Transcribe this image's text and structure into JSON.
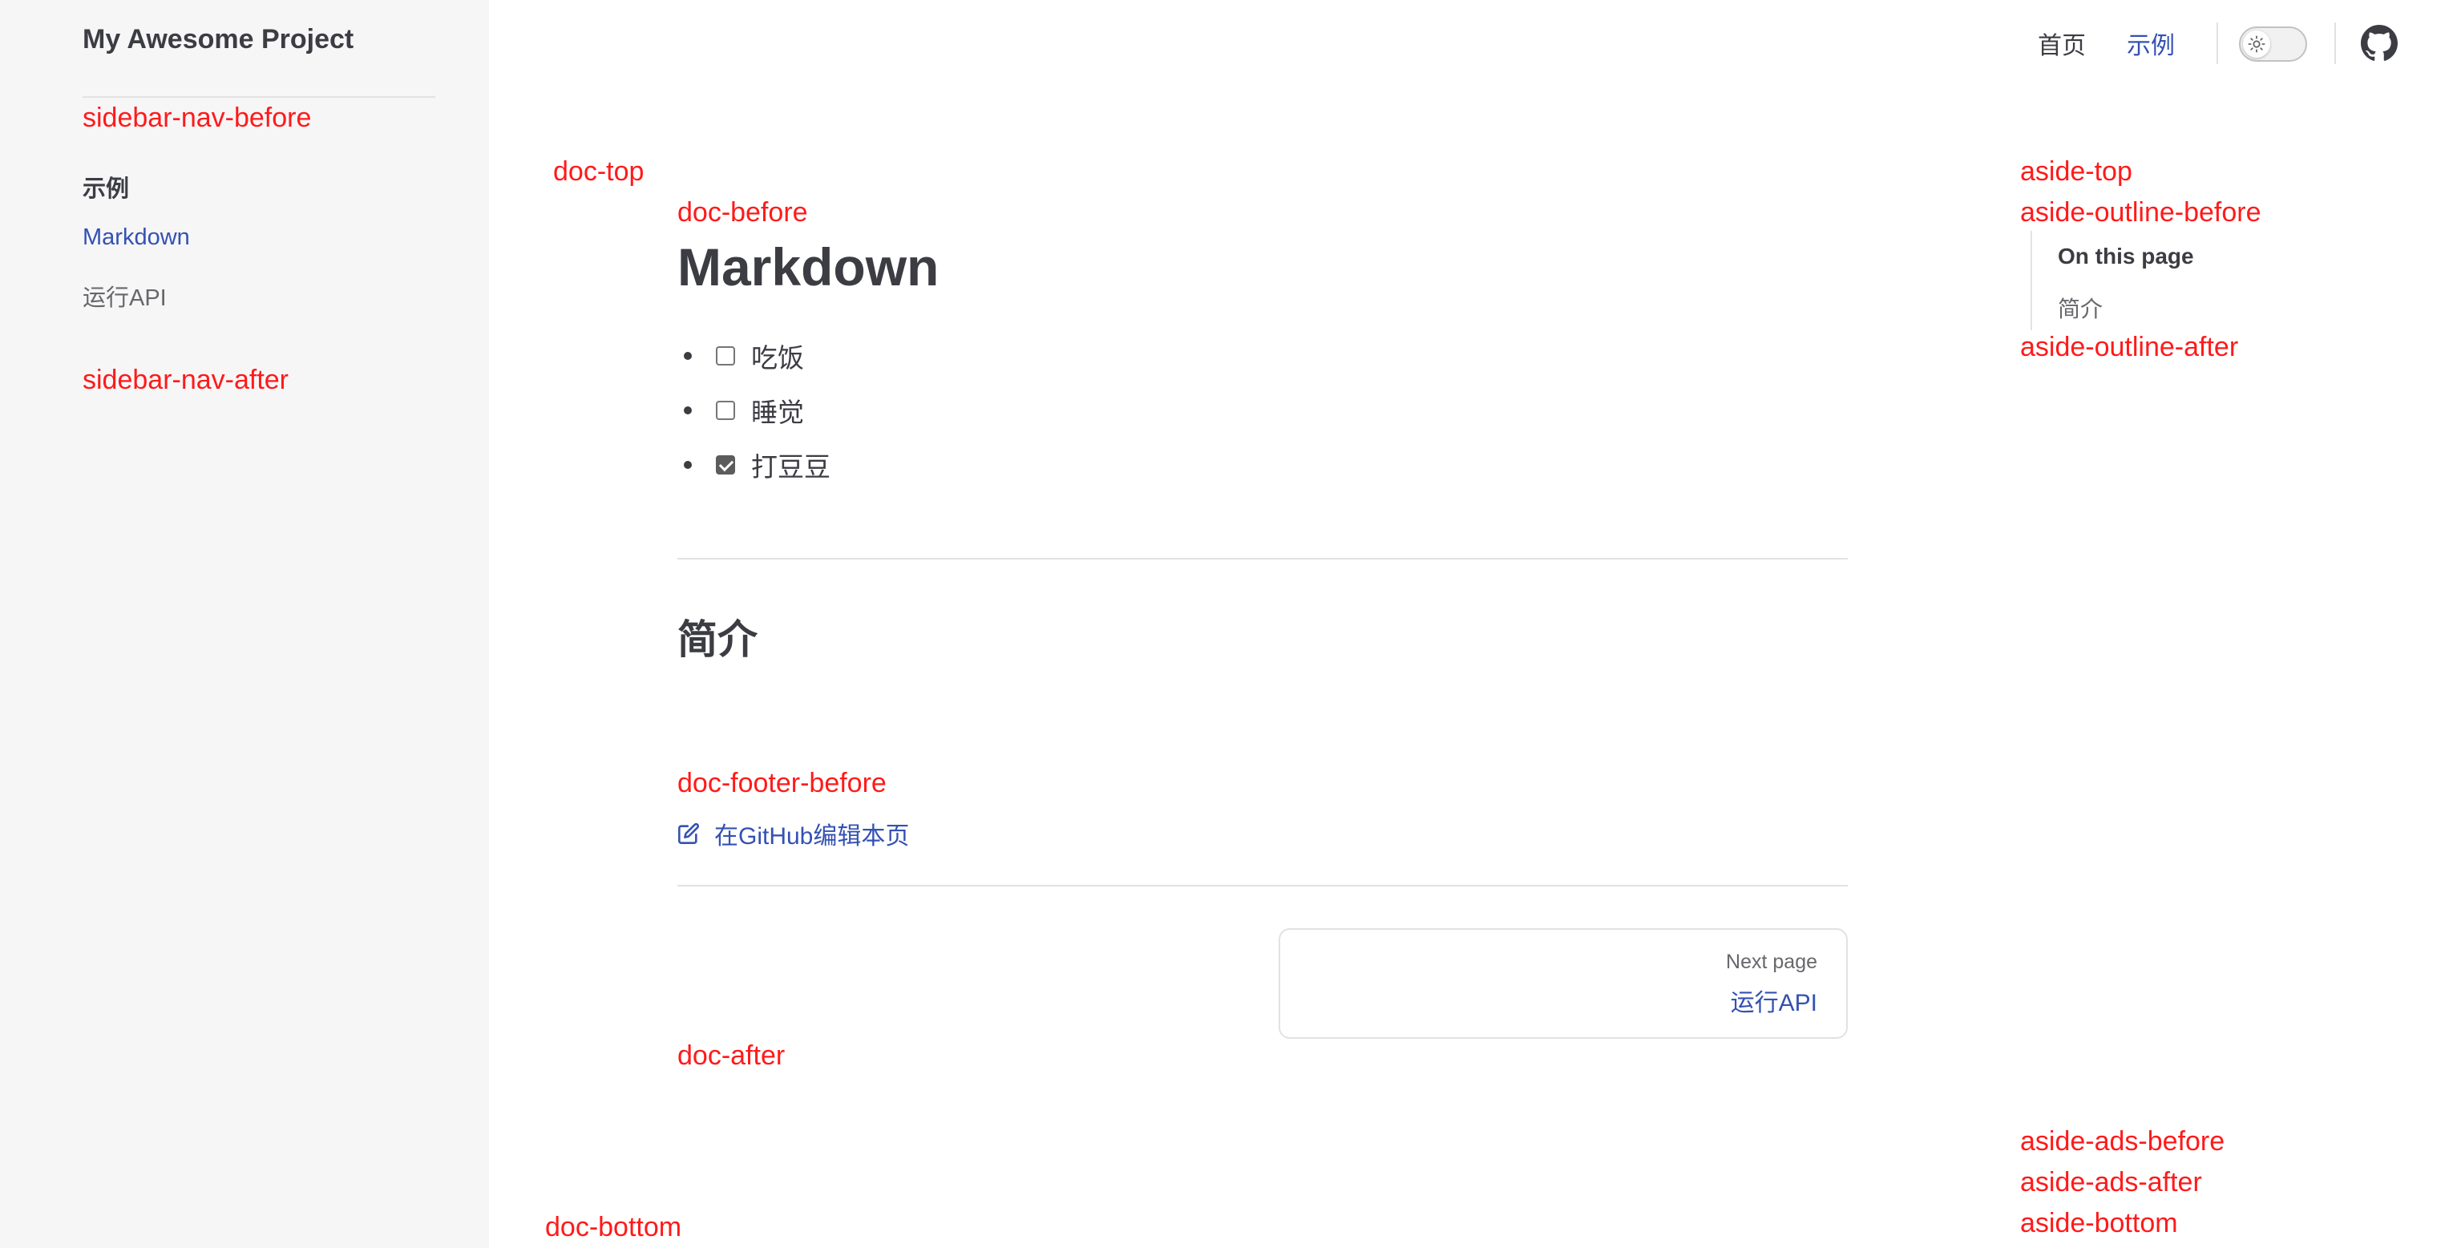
{
  "site": {
    "title": "My Awesome Project"
  },
  "nav": {
    "home": "首页",
    "example": "示例"
  },
  "sidebar": {
    "group_title": "示例",
    "items": [
      {
        "label": "Markdown",
        "active": true
      },
      {
        "label": "运行API",
        "active": false
      }
    ]
  },
  "slots": {
    "sidebar_nav_before": "sidebar-nav-before",
    "sidebar_nav_after": "sidebar-nav-after",
    "doc_top": "doc-top",
    "doc_before": "doc-before",
    "doc_footer_before": "doc-footer-before",
    "doc_after": "doc-after",
    "doc_bottom": "doc-bottom",
    "aside_top": "aside-top",
    "aside_outline_before": "aside-outline-before",
    "aside_outline_after": "aside-outline-after",
    "aside_ads_before": "aside-ads-before",
    "aside_ads_after": "aside-ads-after",
    "aside_bottom": "aside-bottom"
  },
  "doc": {
    "title": "Markdown",
    "tasks": [
      {
        "label": "吃饭",
        "checked": false
      },
      {
        "label": "睡觉",
        "checked": false
      },
      {
        "label": "打豆豆",
        "checked": true
      }
    ],
    "h2": "简介",
    "edit_link": "在GitHub编辑本页",
    "next": {
      "desc": "Next page",
      "title": "运行API"
    }
  },
  "aside": {
    "outline_title": "On this page",
    "outline_items": [
      "简介"
    ]
  },
  "colors": {
    "brand": "#3451b2",
    "slot": "#ff1a1a",
    "sidebar_bg": "#f6f6f7"
  }
}
